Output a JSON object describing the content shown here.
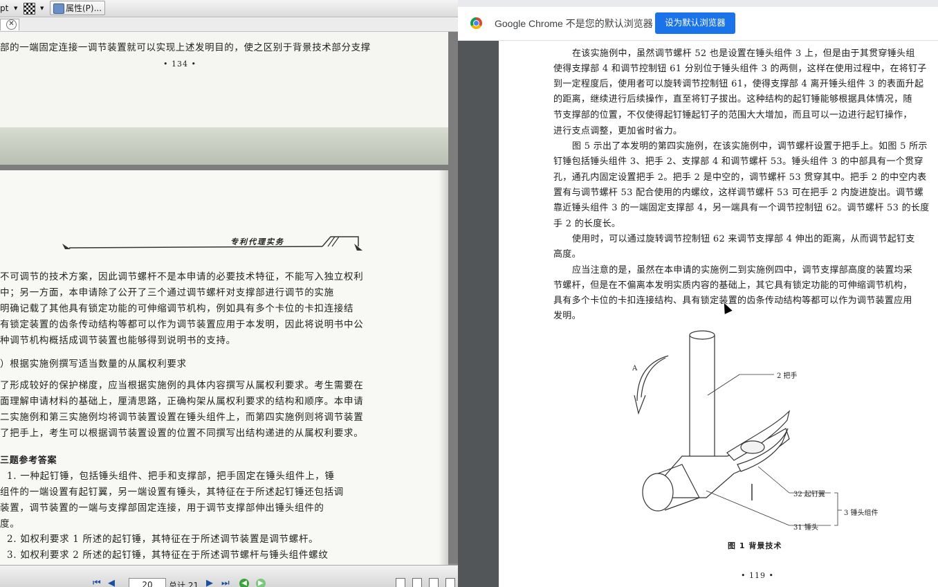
{
  "left_viewer": {
    "toolbar": {
      "zoom_label": "pt",
      "properties_label": "属性(P)..."
    },
    "top_page": {
      "line1": "部的一端固定连接一调节装置就可以实现上述发明目的，使之区别于背景技术部分支撑",
      "page_number": "• 134 •"
    },
    "main_page": {
      "header_title": "专利代理实务",
      "lines": [
        "不可调节的技术方案，因此调节螺杆不是本申请的必要技术特征，不能写入独立权利",
        "中；另一方面，本申请除了公开了三个通过调节螺杆对支撑部进行调节的实施",
        "明确记载了其他具有锁定功能的可伸缩调节机构，例如具有多个卡位的卡扣连接结",
        "有锁定装置的齿条传动结构等都可以作为调节装置应用于本发明，因此将说明书中公",
        "种调节机构概括成调节装置也能够得到说明书的支持。",
        "）根据实施例撰写适当数量的从属权利要求",
        "了形成较好的保护梯度，应当根据实施例的具体内容撰写从属权利要求。考生需要在",
        "面理解申请材料的基础上，厘清思路，正确构架从属权利要求的结构和顺序。本申请",
        "二实施例和第三实施例均将调节装置设置在锤头组件上，而第四实施例则将调节装置",
        "了把手上，考生可以根据调节装置设置的位置不同撰写出结构递进的从属权利要求。",
        "三题参考答案",
        "1. 一种起钉锤，包括锤头组件、把手和支撑部，把手固定在锤头组件上，锤",
        "组件的一端设置有起钉翼，另一端设置有锤头，其特征在于所述起钉锤还包括调",
        "装置，调节装置的一端与支撑部固定连接，用于调节支撑部伸出锤头组件的",
        "度。",
        "2. 如权利要求 1 所述的起钉锤，其特征在于所述调节装置是调节螺杆。",
        "3. 如权利要求 2 所述的起钉锤，其特征在于所述调节螺杆与锤头组件螺纹"
      ]
    },
    "navbar": {
      "current_page": "20",
      "total_pages": "总计 21"
    }
  },
  "chrome": {
    "infobar_text": "Google Chrome 不是您的默认浏览器",
    "set_default_button": "设为默认浏览器"
  },
  "pdf": {
    "lines": [
      "在该实施例中，虽然调节螺杆 52 也是设置在锤头组件 3 上，但是由于其贯穿锤头组",
      "使得支撑部 4 和调节控制钮 61 分别位于锤头组件 3 的两侧，这样在使用过程中，在将钉子",
      "到一定程度后，使用者可以旋转调节控制钮 61，使得支撑部 4 离开锤头组件 3 的表面升起",
      "的距离，继续进行后续操作，直至将钉子拔出。这种结构的起钉锤能够根据具体情况，随",
      "节支撑部的位置，不仅使得起钉锤起钉子的范围大大增加，而且可以一边进行起钉操作，",
      "进行支点调整，更加省时省力。",
      "图 5 示出了本发明的第四实施例，在该实施例中，调节螺杆设置于把手上。如图 5 所示",
      "钉锤包括锤头组件 3、把手 2、支撑部 4 和调节螺杆 53。锤头组件 3 的中部具有一个贯穿",
      "孔，通孔内固定设置把手 2。把手 2 是中空的，调节螺杆 53 贯穿其中。把手 2 的中空内表",
      "置有与调节螺杆 53 配合使用的内螺纹，这样调节螺杆 53 可在把手 2 内旋进旋出。调节螺",
      "靠近锤头组件 3 的一端固定支撑部 4，另一端具有一个调节控制钮 62。调节螺杆 53 的长度",
      "手 2 的长度长。",
      "使用时，可以通过旋转调节控制钮 62 来调节支撑部 4 伸出的距离，从而调节起钉支",
      "高度。",
      "应当注意的是，虽然在本申请的实施例二到实施例四中，调节支撑部高度的装置均采",
      "节螺杆，但是在不偏离本发明实质内容的基础上，其它具有锁定功能的可伸缩调节机构，",
      "具有多个卡位的卡扣连接结构、具有锁定装置的齿条传动结构等都可以作为调节装置应用",
      "发明。"
    ],
    "figure": {
      "label_a": "A",
      "label_handle": "2 把手",
      "label_claw": "32 起钉翼",
      "label_group": "3 锤头组件",
      "label_head": "31 锤头",
      "caption": "图 1   背景技术"
    },
    "page_number": "• 119 •"
  }
}
